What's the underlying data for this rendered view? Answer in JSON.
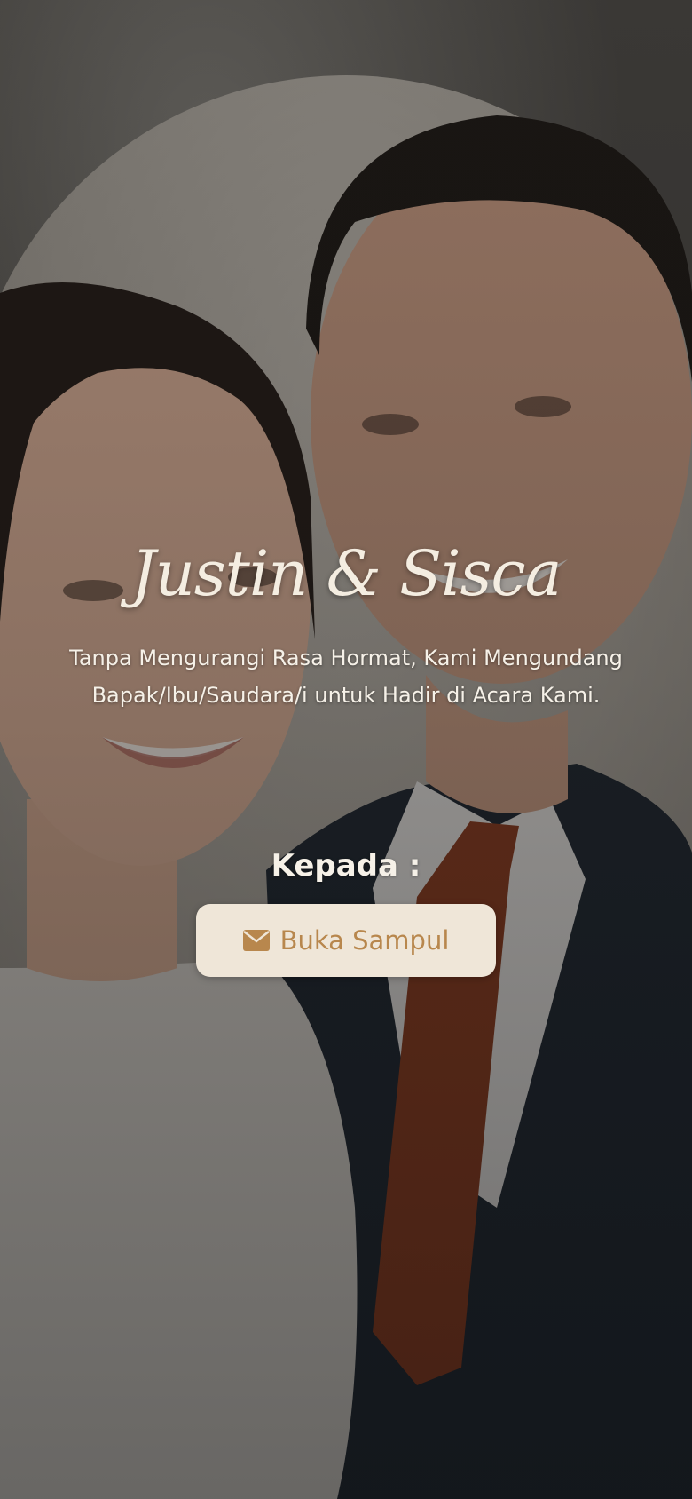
{
  "cover": {
    "couple_names": "Justin & Sisca",
    "invitation_text": "Tanpa Mengurangi Rasa Hormat, Kami Mengundang Bapak/Ibu/Saudara/i untuk Hadir di Acara Kami.",
    "recipient_label": "Kepada :",
    "open_button": {
      "label": "Buka Sampul",
      "icon": "envelope-icon"
    }
  },
  "colors": {
    "button_background": "#efe6d8",
    "button_text": "#b8874d",
    "heading_text": "#f4ede1"
  }
}
